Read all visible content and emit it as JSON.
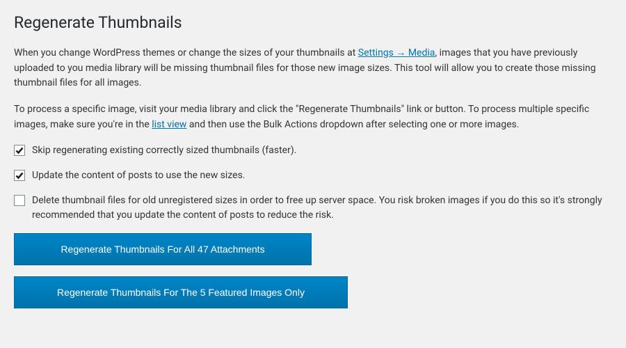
{
  "title": "Regenerate Thumbnails",
  "intro": {
    "part1": "When you change WordPress themes or change the sizes of your thumbnails at ",
    "link1": "Settings → Media",
    "part2": ", images that you have previously uploaded to you media library will be missing thumbnail files for those new image sizes. This tool will allow you to create those missing thumbnail files for all images."
  },
  "para2": {
    "part1": "To process a specific image, visit your media library and click the \"Regenerate Thumbnails\" link or button. To process multiple specific images, make sure you're in the ",
    "link1": "list view",
    "part2": " and then use the Bulk Actions dropdown after selecting one or more images."
  },
  "options": {
    "skip": {
      "checked": true,
      "label": "Skip regenerating existing correctly sized thumbnails (faster)."
    },
    "update": {
      "checked": true,
      "label": "Update the content of posts to use the new sizes."
    },
    "delete": {
      "checked": false,
      "label": "Delete thumbnail files for old unregistered sizes in order to free up server space. You risk broken images if you do this so it's strongly recommended that you update the content of posts to reduce the risk."
    }
  },
  "buttons": {
    "all": "Regenerate Thumbnails For All 47 Attachments",
    "featured": "Regenerate Thumbnails For The 5 Featured Images Only"
  }
}
